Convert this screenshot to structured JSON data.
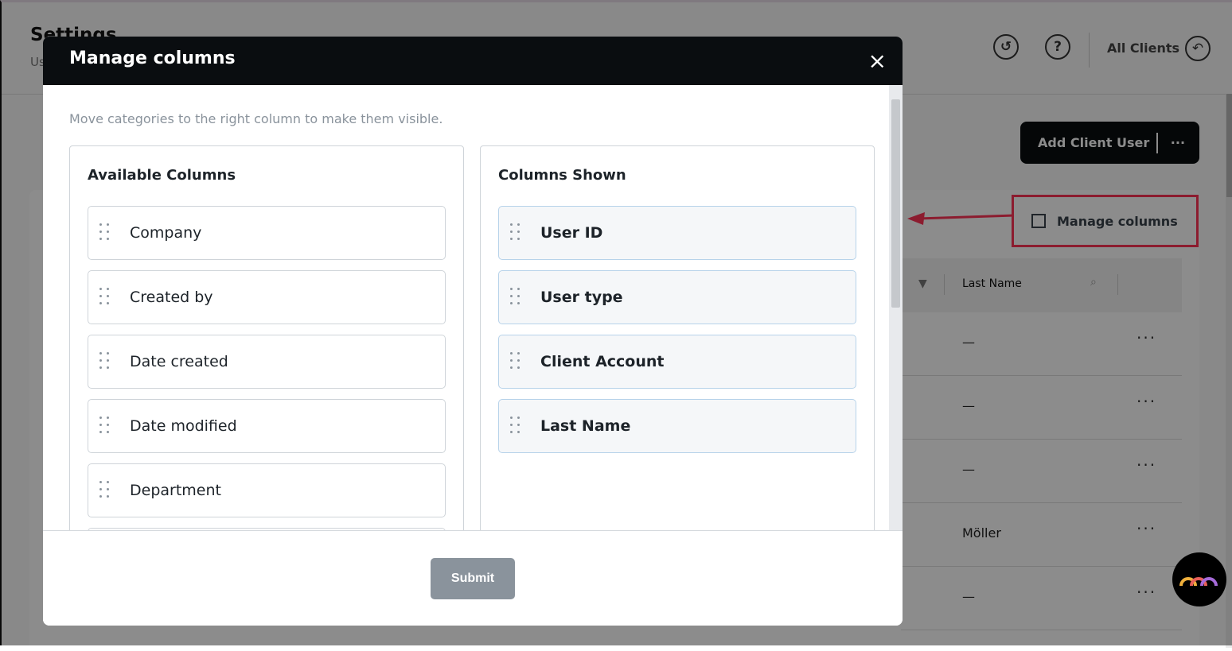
{
  "page": {
    "title": "Settings",
    "subtitle": "Us",
    "all_clients": "All Clients",
    "add_button": "Add Client User",
    "more": "···",
    "manage_columns": "Manage columns",
    "table": {
      "header": "Last Name",
      "rows": [
        {
          "last_name": "—"
        },
        {
          "last_name": "—"
        },
        {
          "last_name": "—"
        },
        {
          "last_name": "Möller"
        },
        {
          "last_name": "—"
        }
      ],
      "row_menu": "···"
    },
    "icons": [
      "history-icon",
      "help-icon",
      "back-arrow-icon",
      "filter-icon",
      "search-icon",
      "columns-icon"
    ]
  },
  "annotation": {
    "color": "#ff3357"
  },
  "modal": {
    "title": "Manage columns",
    "close": "×",
    "hint": "Move categories to the right column to make them visible.",
    "available": {
      "title": "Available Columns",
      "items": [
        "Company",
        "Created by",
        "Date created",
        "Date modified",
        "Department",
        ""
      ]
    },
    "shown": {
      "title": "Columns Shown",
      "items": [
        "User ID",
        "User type",
        "Client Account",
        "Last Name"
      ]
    },
    "submit": "Submit"
  }
}
